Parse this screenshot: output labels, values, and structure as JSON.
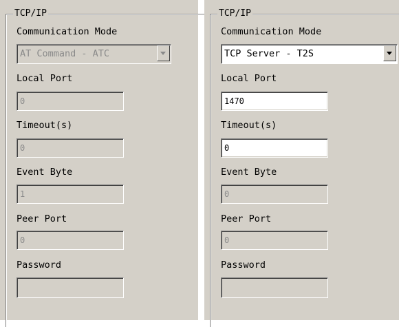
{
  "left_panel": {
    "group_title": "TCP/IP",
    "comm_mode_label": "Communication Mode",
    "comm_mode_value": "AT Command - ATC",
    "local_port_label": "Local Port",
    "local_port_value": "0",
    "timeout_label": "Timeout(s)",
    "timeout_value": "0",
    "event_byte_label": "Event Byte",
    "event_byte_value": "1",
    "peer_port_label": "Peer Port",
    "peer_port_value": "0",
    "password_label": "Password",
    "password_value": ""
  },
  "right_panel": {
    "group_title": "TCP/IP",
    "comm_mode_label": "Communication Mode",
    "comm_mode_value": "TCP Server - T2S",
    "local_port_label": "Local Port",
    "local_port_value": "1470",
    "timeout_label": "Timeout(s)",
    "timeout_value": "0",
    "event_byte_label": "Event Byte",
    "event_byte_value": "0",
    "peer_port_label": "Peer Port",
    "peer_port_value": "0",
    "password_label": "Password",
    "password_value": ""
  }
}
